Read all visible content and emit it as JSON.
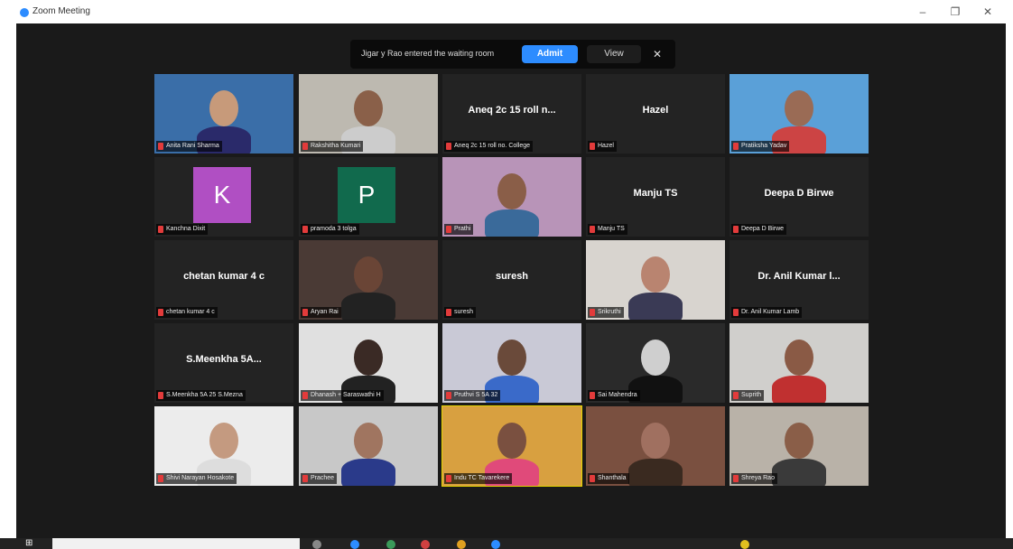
{
  "window": {
    "title": "Zoom Meeting",
    "minimize": "–",
    "maximize": "❐",
    "close": "✕"
  },
  "notification": {
    "text": "Jigar y Rao entered the waiting room",
    "admit_label": "Admit",
    "view_label": "View",
    "close_label": "✕"
  },
  "participants": [
    {
      "row": 0,
      "col": 0,
      "type": "video",
      "name": "Anita Rani Sharma",
      "wall": "#3a6ea8",
      "skin": "#c79a7a",
      "shirt": "#2a2a6a"
    },
    {
      "row": 0,
      "col": 1,
      "type": "video",
      "name": "Rakshitha Kumari",
      "wall": "#bdb9b0",
      "skin": "#8a6049",
      "shirt": "#ccc"
    },
    {
      "row": 0,
      "col": 2,
      "type": "text",
      "display": "Aneq 2c 15 roll n...",
      "name": "Aneq 2c 15 roll no. College"
    },
    {
      "row": 0,
      "col": 3,
      "type": "text",
      "display": "Hazel",
      "name": "Hazel"
    },
    {
      "row": 0,
      "col": 4,
      "type": "video",
      "name": "Pratiksha Yadav",
      "wall": "#5aa0d8",
      "skin": "#9a6b55",
      "shirt": "#c44"
    },
    {
      "row": 1,
      "col": 0,
      "type": "avatar",
      "letter": "K",
      "color": "#b04fc3",
      "name": "Kanchna Dixit"
    },
    {
      "row": 1,
      "col": 1,
      "type": "avatar",
      "letter": "P",
      "color": "#116a4d",
      "name": "pramoda 3 tolga"
    },
    {
      "row": 1,
      "col": 2,
      "type": "video",
      "name": "Prathi",
      "wall": "#b894b8",
      "skin": "#8a5e48",
      "shirt": "#3a6a9a"
    },
    {
      "row": 1,
      "col": 3,
      "type": "text",
      "display": "Manju TS",
      "name": "Manju TS"
    },
    {
      "row": 1,
      "col": 4,
      "type": "text",
      "display": "Deepa D Birwe",
      "name": "Deepa D Birwe"
    },
    {
      "row": 2,
      "col": 0,
      "type": "text",
      "display": "chetan kumar 4 c",
      "name": "chetan kumar 4 c"
    },
    {
      "row": 2,
      "col": 1,
      "type": "video",
      "name": "Aryan Rai",
      "wall": "#4a3a35",
      "skin": "#6a4536",
      "shirt": "#222"
    },
    {
      "row": 2,
      "col": 2,
      "type": "text",
      "display": "suresh",
      "name": "suresh"
    },
    {
      "row": 2,
      "col": 3,
      "type": "video",
      "name": "Srikruthi",
      "wall": "#d8d4cf",
      "skin": "#b98470",
      "shirt": "#3a3a55"
    },
    {
      "row": 2,
      "col": 4,
      "type": "text",
      "display": "Dr. Anil Kumar l...",
      "name": "Dr. Anil Kumar Lamb"
    },
    {
      "row": 3,
      "col": 0,
      "type": "text",
      "display": "S.Meenkha 5A...",
      "name": "S.Meenkha 5A 25 S.Mezna"
    },
    {
      "row": 3,
      "col": 1,
      "type": "video",
      "name": "Dhanash + Saraswathi H",
      "wall": "#e0e0e0",
      "skin": "#3a2a25",
      "shirt": "#222"
    },
    {
      "row": 3,
      "col": 2,
      "type": "video",
      "name": "Pruthvi S 5A 32",
      "wall": "#c9c9d6",
      "skin": "#6a4a3a",
      "shirt": "#3a6ac9"
    },
    {
      "row": 3,
      "col": 3,
      "type": "video",
      "name": "Sai Mahendra",
      "wall": "#2a2a2a",
      "skin": "#cfcfcf",
      "shirt": "#111"
    },
    {
      "row": 3,
      "col": 4,
      "type": "video",
      "name": "Suprith",
      "wall": "#d0cfcc",
      "skin": "#8a5a45",
      "shirt": "#c03030"
    },
    {
      "row": 4,
      "col": 0,
      "type": "video",
      "name": "Shivi Narayan Hosakote",
      "wall": "#ececec",
      "skin": "#c49a80",
      "shirt": "#ddd"
    },
    {
      "row": 4,
      "col": 1,
      "type": "video",
      "name": "Prachee",
      "wall": "#c8c8c8",
      "skin": "#a07560",
      "shirt": "#2a3a8a"
    },
    {
      "row": 4,
      "col": 2,
      "type": "video",
      "active": true,
      "name": "Indu TC Tavarekere",
      "wall": "#d8a040",
      "skin": "#7a5040",
      "shirt": "#e04a7a"
    },
    {
      "row": 4,
      "col": 3,
      "type": "video",
      "name": "Shanthala",
      "wall": "#7a5040",
      "skin": "#a07060",
      "shirt": "#3a2a20"
    },
    {
      "row": 4,
      "col": 4,
      "type": "video",
      "name": "Shreya Rao",
      "wall": "#b9b2a8",
      "skin": "#8a5e48",
      "shirt": "#3a3a3a"
    }
  ],
  "taskbar": {
    "start_label": "⊞",
    "search_placeholder": ""
  },
  "colors": {
    "meeting_bg": "#1a1a1a",
    "tile_bg": "#232323",
    "accent": "#2d8cff",
    "active_speaker": "#e4d400",
    "muted": "#e23b3b"
  }
}
